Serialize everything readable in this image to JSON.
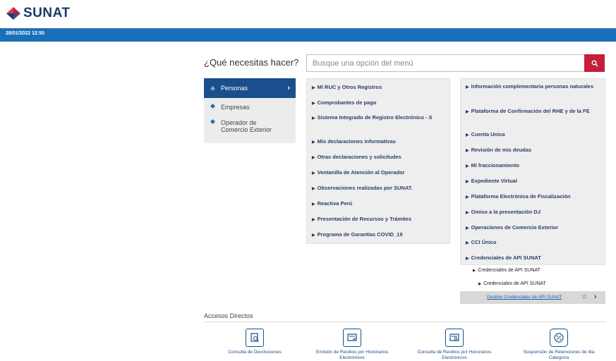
{
  "header": {
    "logo_text": "SUNAT",
    "datetime": "28/01/2022 12:50"
  },
  "search": {
    "question": "¿Qué necesitas hacer?",
    "placeholder": "Busque una opción del menú"
  },
  "categories": [
    {
      "label": "Personas",
      "active": true
    },
    {
      "label": "Empresas",
      "active": false
    },
    {
      "label": "Operador de Comercio Exterior",
      "active": false
    }
  ],
  "menu_left": [
    "Mi RUC y Otros Registros",
    "Comprobantes de pago",
    "Sistema Integrado de Registro Electrónico - S",
    "Mis declaraciones informativas",
    "Otras declaraciones y solicitudes",
    "Ventanilla de Atención al Operador",
    "Observaciones realizadas por SUNAT.",
    "Reactiva Perú",
    "Presentación de Recursos y Trámites",
    "Programa de Garantías COVID_19"
  ],
  "menu_right": [
    "Información complementaria personas naturales",
    "Plataforma de Confirmación del RHE y de la FE",
    "Cuenta Unica",
    "Revisión de mis deudas",
    "Mi fraccionamiento",
    "Expediente Virtual",
    "Plataforma Electrónica de Fiscalización",
    "Omiso a la presentación DJ",
    "Operaciones de Comercio Exterior",
    "CCI Único",
    "Credenciales de API SUNAT"
  ],
  "submenu": {
    "level1": "Credenciales de API SUNAT",
    "level2": "Credenciales de API SUNAT",
    "link": "Gestión Credenciales de API SUNAT"
  },
  "accesos": {
    "title": "Accesos Directos",
    "items": [
      {
        "label": "Consulta de Devoluciones",
        "icon": "document-search-icon"
      },
      {
        "label": "Emisión de Recibos por Honorarios Electrónicos",
        "icon": "receipt-issue-icon"
      },
      {
        "label": "Consulta de Recibos por Honorarios Electrónicos",
        "icon": "receipt-search-icon"
      },
      {
        "label": "Suspensión de Retenciones de 4ta Categoría",
        "icon": "percent-icon"
      }
    ]
  },
  "colors": {
    "brand_blue": "#1a70b8",
    "active_blue": "#1a4e8c",
    "search_red": "#c41e3a",
    "logo_red": "#c41e3a",
    "logo_navy": "#1b3a6b"
  }
}
